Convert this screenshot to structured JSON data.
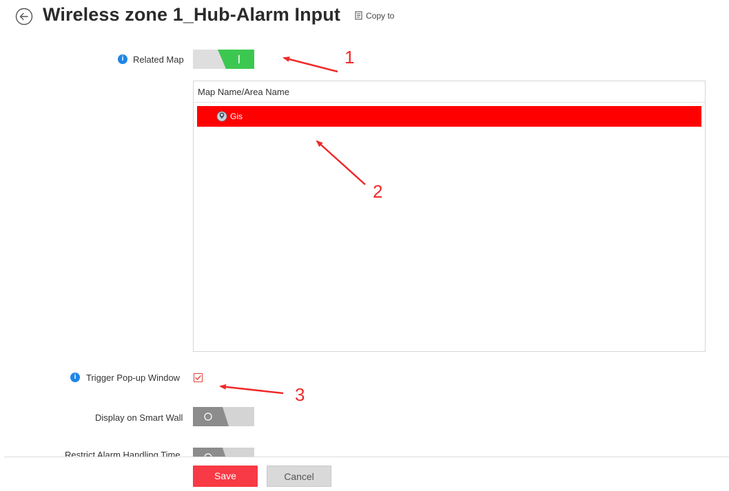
{
  "header": {
    "title": "Wireless zone 1_Hub-Alarm Input",
    "copy_to_label": "Copy to"
  },
  "form": {
    "related_map": {
      "label": "Related Map",
      "enabled": true
    },
    "map_table": {
      "column_header": "Map Name/Area Name",
      "rows": [
        {
          "name": "Gis",
          "selected": true
        }
      ]
    },
    "trigger_popup": {
      "label": "Trigger Pop-up Window",
      "checked": true
    },
    "display_smart_wall": {
      "label": "Display on Smart Wall",
      "enabled": false
    },
    "restrict_alarm_handling": {
      "label": "Restrict Alarm Handling Time",
      "enabled": false
    }
  },
  "footer": {
    "save_label": "Save",
    "cancel_label": "Cancel"
  },
  "annotations": [
    "1",
    "2",
    "3"
  ],
  "colors": {
    "accent_red": "#ff0000",
    "save_button": "#f73a45",
    "toggle_on": "#3cc850",
    "toggle_off": "#8c8c8c",
    "info_blue": "#1e86e6",
    "annotation_red": "#ef2a2a"
  }
}
